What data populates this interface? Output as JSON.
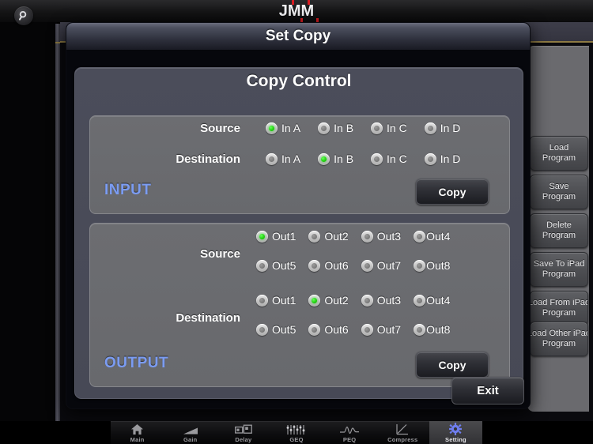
{
  "app": {
    "logo": "JMM",
    "search_icon": "search-icon"
  },
  "dialog": {
    "title": "Set Copy",
    "panel_title": "Copy Control",
    "exit_label": "Exit"
  },
  "input_section": {
    "label": "INPUT",
    "copy_label": "Copy",
    "source_label": "Source",
    "destination_label": "Destination",
    "source_options": [
      {
        "label": "In A",
        "selected": true
      },
      {
        "label": "In B",
        "selected": false
      },
      {
        "label": "In C",
        "selected": false
      },
      {
        "label": "In D",
        "selected": false
      }
    ],
    "destination_options": [
      {
        "label": "In A",
        "selected": false
      },
      {
        "label": "In B",
        "selected": true
      },
      {
        "label": "In C",
        "selected": false
      },
      {
        "label": "In D",
        "selected": false
      }
    ]
  },
  "output_section": {
    "label": "OUTPUT",
    "copy_label": "Copy",
    "source_label": "Source",
    "destination_label": "Destination",
    "source_options": [
      {
        "label": "Out1",
        "selected": true
      },
      {
        "label": "Out2",
        "selected": false
      },
      {
        "label": "Out3",
        "selected": false
      },
      {
        "label": "Out4",
        "selected": false
      },
      {
        "label": "Out5",
        "selected": false
      },
      {
        "label": "Out6",
        "selected": false
      },
      {
        "label": "Out7",
        "selected": false
      },
      {
        "label": "Out8",
        "selected": false
      }
    ],
    "destination_options": [
      {
        "label": "Out1",
        "selected": false
      },
      {
        "label": "Out2",
        "selected": true
      },
      {
        "label": "Out3",
        "selected": false
      },
      {
        "label": "Out4",
        "selected": false
      },
      {
        "label": "Out5",
        "selected": false
      },
      {
        "label": "Out6",
        "selected": false
      },
      {
        "label": "Out7",
        "selected": false
      },
      {
        "label": "Out8",
        "selected": false
      }
    ]
  },
  "rail": {
    "buttons": [
      {
        "line1": "Load",
        "line2": "Program"
      },
      {
        "line1": "Save",
        "line2": "Program"
      },
      {
        "line1": "Delete",
        "line2": "Program"
      },
      {
        "line1": "Save To iPad",
        "line2": "Program"
      },
      {
        "line1": "Load From iPad",
        "line2": "Program"
      },
      {
        "line1": "Load Other iPad",
        "line2": "Program"
      }
    ]
  },
  "tabbar": {
    "tabs": [
      {
        "label": "Main",
        "icon": "home-icon",
        "active": false
      },
      {
        "label": "Gain",
        "icon": "ramp-icon",
        "active": false
      },
      {
        "label": "Delay",
        "icon": "delay-icon",
        "active": false
      },
      {
        "label": "GEQ",
        "icon": "sliders-icon",
        "active": false
      },
      {
        "label": "PEQ",
        "icon": "waveform-icon",
        "active": false
      },
      {
        "label": "Compress",
        "icon": "compressor-curve-icon",
        "active": false
      },
      {
        "label": "Setting",
        "icon": "gear-icon",
        "active": true
      }
    ]
  },
  "colors": {
    "accent_blue": "#7b9cf2",
    "selected_green": "#22d411",
    "logo_red": "#d81c21"
  }
}
